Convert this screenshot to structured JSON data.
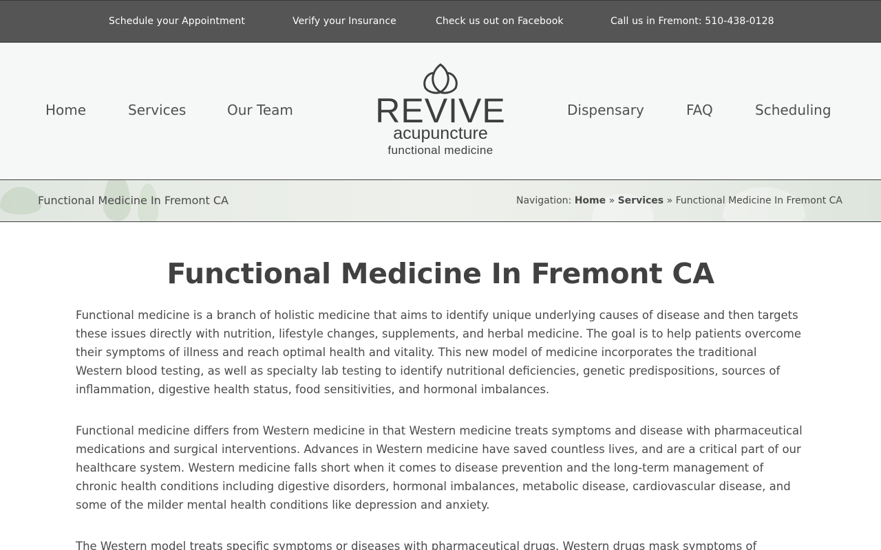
{
  "topbar": {
    "links": [
      "Schedule your Appointment",
      "Verify your Insurance",
      "Check us out on Facebook",
      "Call us in Fremont: 510-438-0128"
    ]
  },
  "nav": {
    "left": [
      "Home",
      "Services",
      "Our Team"
    ],
    "right": [
      "Dispensary",
      "FAQ",
      "Scheduling"
    ]
  },
  "logo": {
    "brand": "REVIVE",
    "line1": "acupuncture",
    "line2": "functional medicine"
  },
  "breadcrumb": {
    "page_title": "Functional Medicine In Fremont CA",
    "prefix": "Navigation:",
    "home": "Home",
    "separator": "»",
    "services": "Services",
    "current": "Functional Medicine In Fremont CA"
  },
  "content": {
    "title": "Functional Medicine In Fremont CA",
    "paragraphs": [
      "Functional medicine is a branch of holistic medicine that aims to identify unique underlying causes of disease and then targets these issues directly with nutrition, lifestyle changes, supplements, and herbal medicine. The goal is to help patients overcome their symptoms of illness and reach optimal health and vitality. This new model of medicine incorporates the traditional Western blood testing, as well as specialty lab testing to identify nutritional deficiencies, genetic predispositions, sources of inflammation, digestive health status, food sensitivities, and hormonal imbalances.",
      "Functional medicine differs from Western medicine in that Western medicine treats symptoms and disease with pharmaceutical medications and surgical interventions. Advances in Western medicine have saved countless lives, and are a critical part of our healthcare system. Western medicine falls short when it comes to disease prevention and the long-term management of chronic health conditions including digestive disorders, hormonal imbalances, metabolic disease, cardiovascular disease, and some of the milder mental health conditions like depression and anxiety.",
      "The Western model treats specific symptoms or diseases with pharmaceutical drugs. Western drugs mask symptoms of disease,"
    ]
  },
  "colors": {
    "topbar_bg": "#555555",
    "header_bg": "#f6f7f7",
    "text": "#444444"
  }
}
